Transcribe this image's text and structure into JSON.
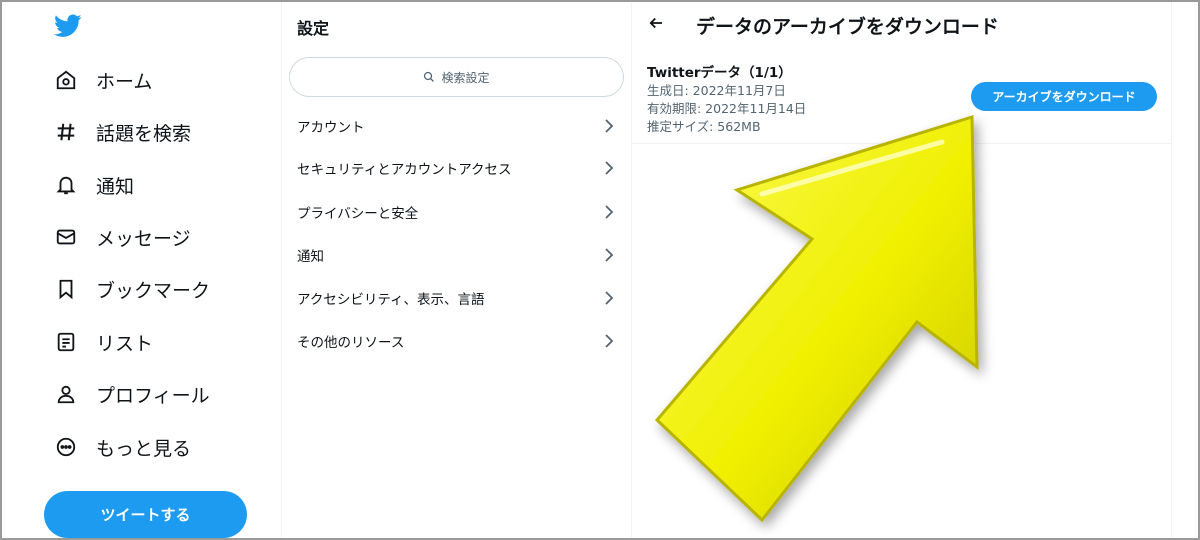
{
  "nav": {
    "items": [
      {
        "label": "ホーム",
        "icon": "home-icon"
      },
      {
        "label": "話題を検索",
        "icon": "hashtag-icon"
      },
      {
        "label": "通知",
        "icon": "bell-icon"
      },
      {
        "label": "メッセージ",
        "icon": "envelope-icon"
      },
      {
        "label": "ブックマーク",
        "icon": "bookmark-icon"
      },
      {
        "label": "リスト",
        "icon": "list-icon"
      },
      {
        "label": "プロフィール",
        "icon": "person-icon"
      },
      {
        "label": "もっと見る",
        "icon": "more-circle-icon"
      }
    ],
    "tweet_label": "ツイートする"
  },
  "settings": {
    "title": "設定",
    "search_placeholder": "検索設定",
    "items": [
      {
        "label": "アカウント"
      },
      {
        "label": "セキュリティとアカウントアクセス"
      },
      {
        "label": "プライバシーと安全"
      },
      {
        "label": "通知"
      },
      {
        "label": "アクセシビリティ、表示、言語"
      },
      {
        "label": "その他のリソース"
      }
    ]
  },
  "detail": {
    "title": "データのアーカイブをダウンロード",
    "archive_name": "Twitterデータ（1/1）",
    "created": "生成日: 2022年11月7日",
    "expires": "有効期限: 2022年11月14日",
    "size": "推定サイズ: 562MB",
    "download_label": "アーカイブをダウンロード"
  },
  "colors": {
    "accent": "#1d9bf0",
    "overlay_arrow": "#f2f000"
  }
}
